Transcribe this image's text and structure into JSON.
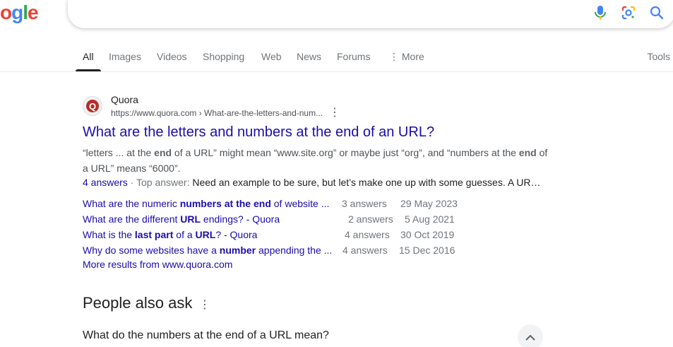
{
  "logo": {
    "text": "ogle"
  },
  "search": {
    "value": ""
  },
  "tabs": [
    {
      "label": "All"
    },
    {
      "label": "Images"
    },
    {
      "label": "Videos"
    },
    {
      "label": "Shopping"
    },
    {
      "label": "Web"
    },
    {
      "label": "News"
    },
    {
      "label": "Forums"
    },
    {
      "label": "More"
    }
  ],
  "tools_label": "Tools",
  "result": {
    "site_name": "Quora",
    "url": "https://www.quora.com › What-are-the-letters-and-num...",
    "title": "What are the letters and numbers at the end of an URL?",
    "snippet_parts": {
      "p1": "“letters ... at the ",
      "b1": "end",
      "p2": " of a URL” might mean “www.site.org” or maybe just “org”, and “numbers at the ",
      "b2": "end",
      "p3": " of a URL” means “6000”."
    },
    "answers_link": "4 answers",
    "top_answer_label": " · Top answer: ",
    "top_answer_text": "Need an example to be sure, but let’s make one up with some guesses. A UR…",
    "related": [
      {
        "pre": "What are the numeric ",
        "bold": "numbers at the end",
        "post": " of website ...",
        "count": "3 answers",
        "date": "29 May 2023"
      },
      {
        "pre": "What are the different ",
        "bold": "URL",
        "post": " endings? - Quora",
        "count": "2 answers",
        "date": "5 Aug 2021"
      },
      {
        "pre": "What is the ",
        "bold": "last part",
        "mid": " of a ",
        "bold2": "URL",
        "post": "? - Quora",
        "count": "4 answers",
        "date": "30 Oct 2019"
      },
      {
        "pre": "Why do some websites have a ",
        "bold": "number",
        "post": " appending the ...",
        "count": "4 answers",
        "date": "15 Dec 2016"
      }
    ],
    "more_results": "More results from www.quora.com"
  },
  "paa": {
    "title": "People also ask",
    "questions": [
      "What do the numbers at the end of a URL mean?"
    ]
  },
  "colors": {
    "link": "#1a0dab",
    "text": "#202124",
    "muted": "#4d5156"
  }
}
